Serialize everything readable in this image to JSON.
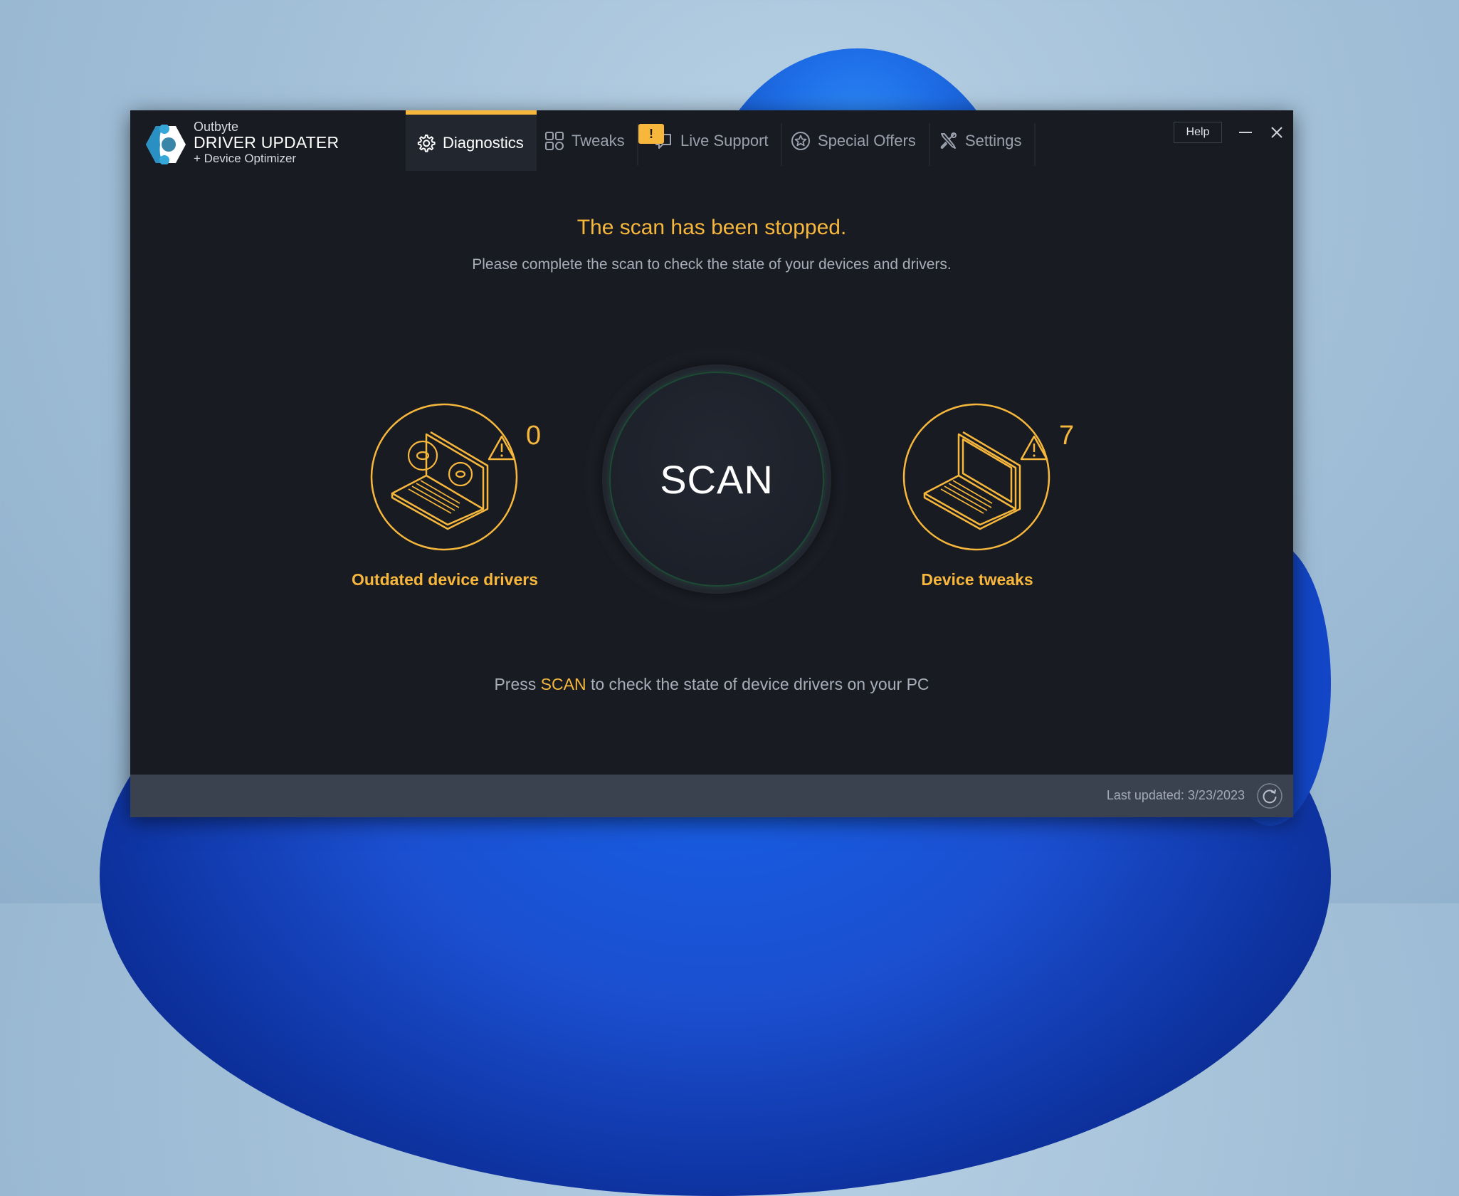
{
  "app": {
    "brand_top": "Outbyte",
    "brand_main": "DRIVER UPDATER",
    "brand_sub": "+ Device Optimizer"
  },
  "tabs": [
    {
      "label": "Diagnostics",
      "icon": "gear-icon",
      "active": true
    },
    {
      "label": "Tweaks",
      "icon": "grid-icon",
      "active": false
    },
    {
      "label": "Live Support",
      "icon": "chat-icon",
      "active": false,
      "badge": "!"
    },
    {
      "label": "Special Offers",
      "icon": "star-icon",
      "active": false
    },
    {
      "label": "Settings",
      "icon": "wrench-screwdriver-icon",
      "active": false
    }
  ],
  "window_controls": {
    "help_label": "Help",
    "minimize": "minimize-icon",
    "close": "close-icon"
  },
  "main": {
    "heading": "The scan has been stopped.",
    "subtitle": "Please complete the scan to check the state of your devices and drivers.",
    "scan_label": "SCAN",
    "stats": [
      {
        "label": "Outdated device drivers",
        "count": "0",
        "icon": "laptop-gears-icon"
      },
      {
        "label": "Device tweaks",
        "count": "7",
        "icon": "laptop-icon"
      }
    ],
    "hint_prefix": "Press ",
    "hint_highlight": "SCAN",
    "hint_suffix": " to check the state of device drivers on your PC"
  },
  "footer": {
    "last_updated": "Last updated: 3/23/2023"
  },
  "colors": {
    "accent": "#f6b73c",
    "window_bg": "#181b22",
    "footer_bg": "#3a4250",
    "logo_blue": "#35a8d8"
  }
}
